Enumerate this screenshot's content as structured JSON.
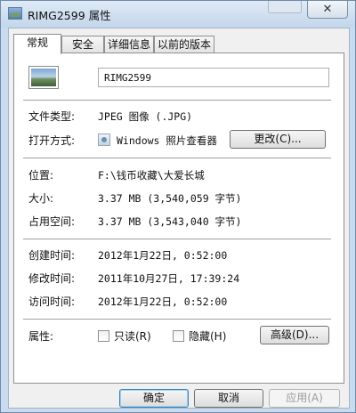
{
  "window": {
    "title": "RIMG2599 属性",
    "close_glyph": "✕"
  },
  "tabs": [
    {
      "label": "常规"
    },
    {
      "label": "安全"
    },
    {
      "label": "详细信息"
    },
    {
      "label": "以前的版本"
    }
  ],
  "general": {
    "file_name": "RIMG2599",
    "file_type_label": "文件类型:",
    "file_type_value": "JPEG 图像 (.JPG)",
    "opens_with_label": "打开方式:",
    "opens_with_value": "Windows 照片查看器",
    "change_button": "更改(C)...",
    "location_label": "位置:",
    "location_value": "F:\\钱币收藏\\大爱长城",
    "size_label": "大小:",
    "size_value": "3.37 MB (3,540,059 字节)",
    "size_on_disk_label": "占用空间:",
    "size_on_disk_value": "3.37 MB (3,543,040 字节)",
    "created_label": "创建时间:",
    "created_value": "2012年1月22日, 0:52:00",
    "modified_label": "修改时间:",
    "modified_value": "2011年10月27日, 17:39:24",
    "accessed_label": "访问时间:",
    "accessed_value": "2012年1月22日, 0:52:00",
    "attributes_label": "属性:",
    "readonly_label": "只读(R)",
    "readonly_checked": false,
    "hidden_label": "隐藏(H)",
    "hidden_checked": false,
    "advanced_button": "高级(D)..."
  },
  "footer": {
    "ok_label": "确定",
    "cancel_label": "取消",
    "apply_label": "应用(A)"
  }
}
